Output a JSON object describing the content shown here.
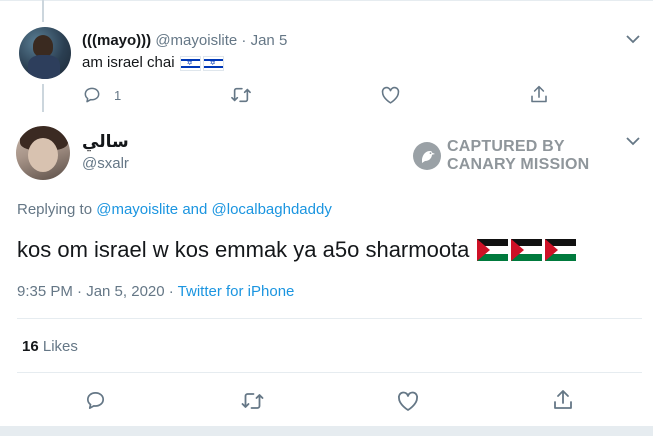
{
  "parent_tweet": {
    "display_name": "(((mayo)))",
    "handle": "@mayoislite",
    "separator": "·",
    "date": "Jan 5",
    "text": "am israel chai",
    "reply_count": "1"
  },
  "main_tweet": {
    "display_name": "سالي",
    "handle": "@sxalr",
    "replying_prefix": "Replying to",
    "replying_user_1": "@mayoislite",
    "replying_and": "and",
    "replying_user_2": "@localbaghdaddy",
    "text": "kos om israel w kos emmak ya a5o sharmoota",
    "time": "9:35 PM · Jan 5, 2020",
    "separator": "·",
    "source": "Twitter for iPhone",
    "likes_count": "16",
    "likes_label": "Likes"
  },
  "watermark": {
    "line1": "CAPTURED BY",
    "line2": "CANARY MISSION"
  },
  "colors": {
    "link": "#1b95e0",
    "muted": "#657786",
    "text": "#14171a",
    "divider": "#e6ecf0",
    "palestine_red": "#ce1126",
    "palestine_green": "#007a3d",
    "israel_blue": "#0038b8"
  }
}
